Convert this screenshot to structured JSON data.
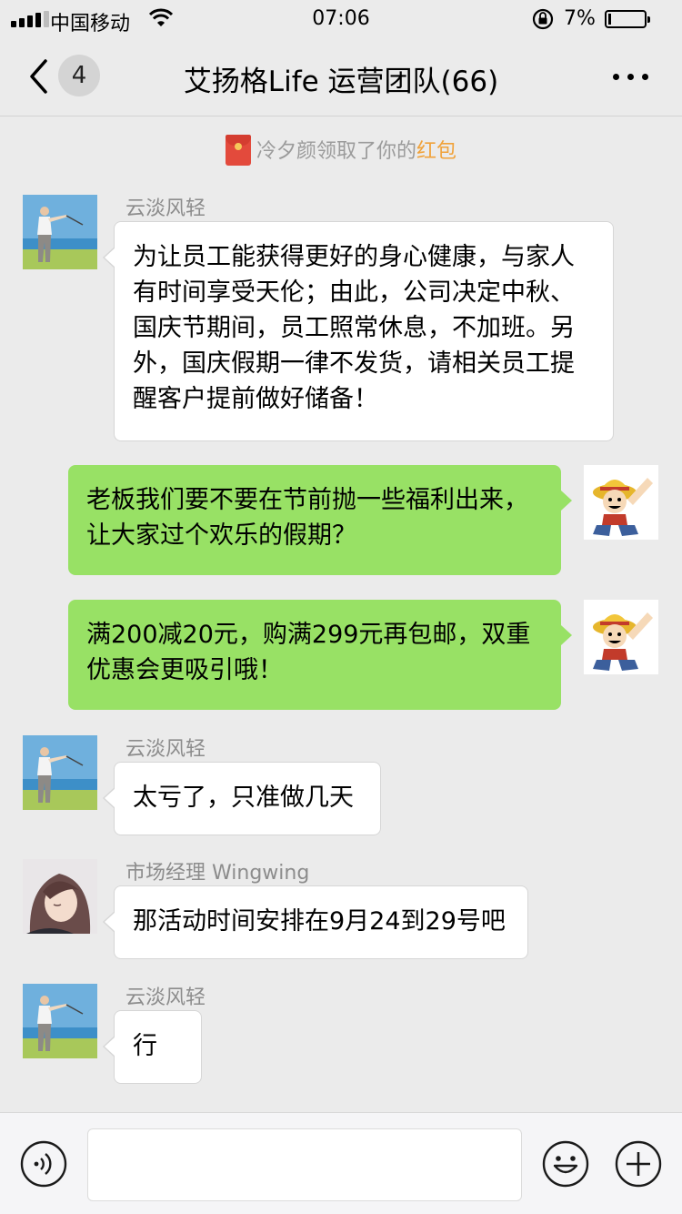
{
  "status_bar": {
    "carrier": "中国移动",
    "time": "07:06",
    "battery": "7%",
    "battery_level": 0.07
  },
  "nav": {
    "unread_count": "4",
    "title": "艾扬格Life 运营团队(66)"
  },
  "system_notice": {
    "text": "冷夕颜领取了你的",
    "link": "红包"
  },
  "messages": [
    {
      "side": "left",
      "sender": "云淡风轻",
      "avatar": "golfer-avatar",
      "text": "为让员工能获得更好的身心健康，与家人有时间享受天伦；由此，公司决定中秋、国庆节期间，员工照常休息，不加班。另外，国庆假期一律不发货，请相关员工提醒客户提前做好储备！"
    },
    {
      "side": "right",
      "avatar": "luffy-avatar",
      "text": "老板我们要不要在节前抛一些福利出来，让大家过个欢乐的假期？"
    },
    {
      "side": "right",
      "avatar": "luffy-avatar",
      "text": "满200减20元，购满299元再包邮，双重优惠会更吸引哦！"
    },
    {
      "side": "left",
      "sender": "云淡风轻",
      "avatar": "golfer-avatar",
      "text": "太亏了，只准做几天"
    },
    {
      "side": "left",
      "sender": "市场经理 Wingwing",
      "avatar": "girl-avatar",
      "text": "那活动时间安排在9月24到29号吧"
    },
    {
      "side": "left",
      "sender": "云淡风轻",
      "avatar": "golfer-avatar",
      "text": "行"
    }
  ],
  "input_bar": {
    "value": "",
    "icons": [
      "voice-icon",
      "emoji-icon",
      "plus-icon"
    ]
  },
  "colors": {
    "background": "#ebebeb",
    "bubble_self": "#98e165",
    "bubble_other": "#ffffff",
    "red_packet_link": "#f0a23a"
  }
}
